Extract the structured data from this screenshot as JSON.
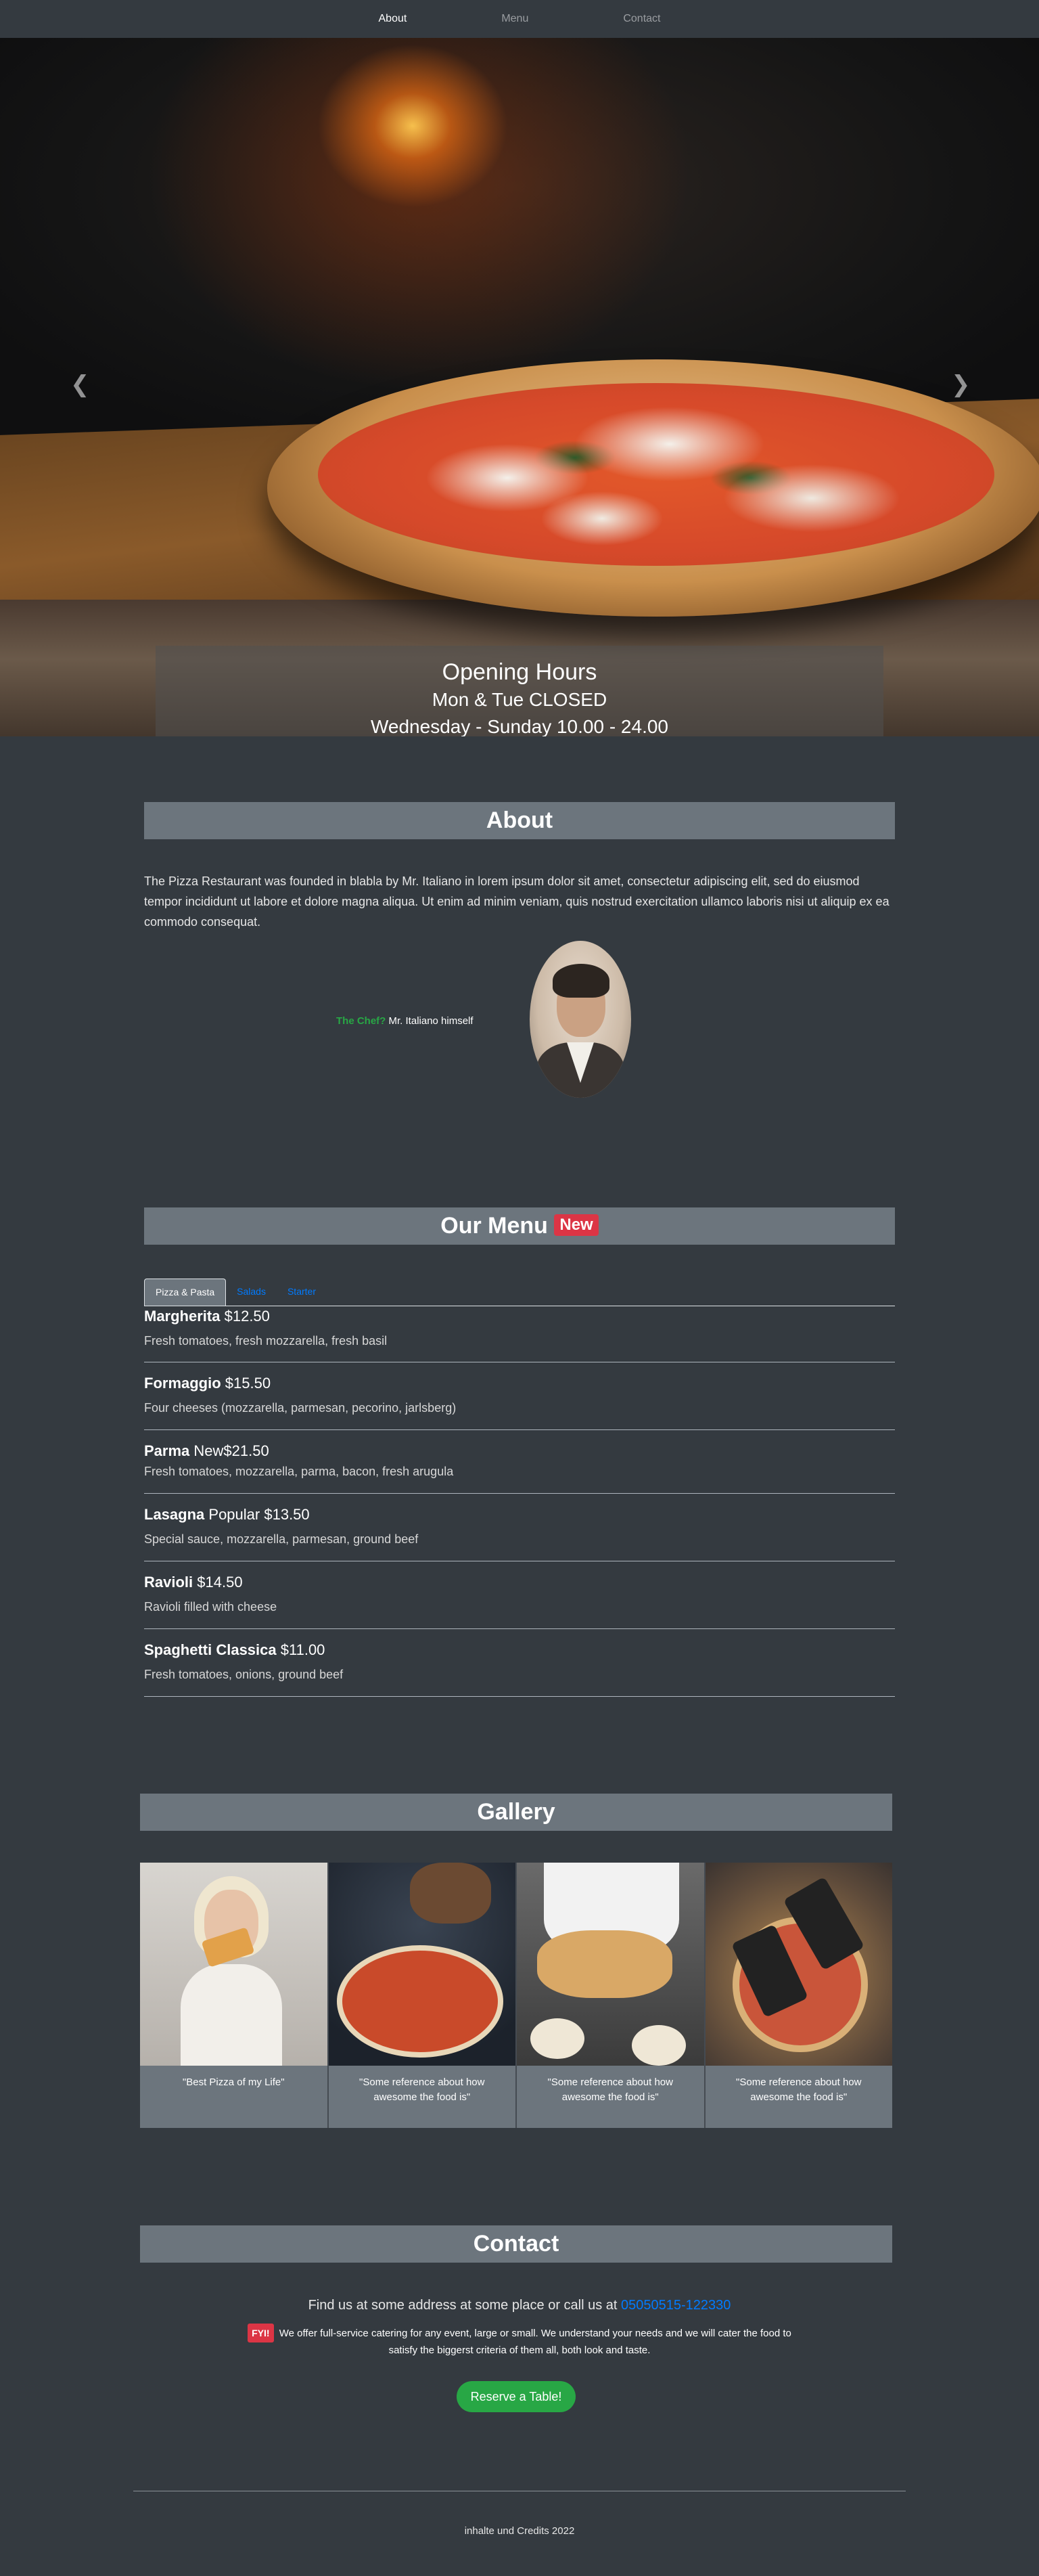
{
  "nav": {
    "items": [
      {
        "label": "About",
        "active": true
      },
      {
        "label": "Menu",
        "active": false
      },
      {
        "label": "Contact",
        "active": false
      }
    ]
  },
  "hero": {
    "caption_title": "Opening Hours",
    "caption_sub": "Mon & Tue CLOSED",
    "caption_hours": "Wednesday - Sunday 10.00 - 24.00",
    "prev_icon": "chevron-left-icon",
    "next_icon": "chevron-right-icon",
    "slide_count": 3,
    "active_slide": 2
  },
  "about": {
    "heading": "About",
    "text": "The Pizza Restaurant was founded in blabla by Mr. Italiano in lorem ipsum dolor sit amet, consectetur adipiscing elit, sed do eiusmod tempor incididunt ut labore et dolore magna aliqua. Ut enim ad minim veniam, quis nostrud exercitation ullamco laboris nisi ut aliquip ex ea commodo consequat.",
    "chef_label": "The Chef?",
    "chef_name": "Mr. Italiano himself"
  },
  "menu": {
    "heading": "Our Menu",
    "badge": "New",
    "tabs": [
      {
        "label": "Pizza & Pasta",
        "active": true
      },
      {
        "label": "Salads",
        "active": false
      },
      {
        "label": "Starter",
        "active": false
      }
    ],
    "items": [
      {
        "name": "Margherita",
        "tag": "",
        "price": "$12.50",
        "desc": "Fresh tomatoes, fresh mozzarella, fresh basil"
      },
      {
        "name": "Formaggio",
        "tag": "",
        "price": "$15.50",
        "desc": "Four cheeses (mozzarella, parmesan, pecorino, jarlsberg)"
      },
      {
        "name": "Parma",
        "tag": "New",
        "price": "$21.50",
        "desc": "Fresh tomatoes, mozzarella, parma, bacon, fresh arugula"
      },
      {
        "name": "Lasagna",
        "tag": "Popular",
        "price": "$13.50",
        "desc": "Special sauce, mozzarella, parmesan, ground beef"
      },
      {
        "name": "Ravioli",
        "tag": "",
        "price": "$14.50",
        "desc": "Ravioli filled with cheese"
      },
      {
        "name": "Spaghetti Classica",
        "tag": "",
        "price": "$11.00",
        "desc": "Fresh tomatoes, onions, ground beef"
      }
    ]
  },
  "gallery": {
    "heading": "Gallery",
    "cards": [
      {
        "caption": "\"Best Pizza of my Life\""
      },
      {
        "caption": "\"Some reference about how awesome the food is\""
      },
      {
        "caption": "\"Some reference about how awesome the food is\""
      },
      {
        "caption": "\"Some reference about how awesome the food is\""
      }
    ]
  },
  "contact": {
    "heading": "Contact",
    "line": "Find us at some address at some place or call us at",
    "phone": "05050515-122330",
    "fyi_badge": "FYI!",
    "fyi_text": "We offer full-service catering for any event, large or small. We understand your needs and we will cater the food to satisfy the biggerst criteria of them all, both look and taste.",
    "button": "Reserve a Table!"
  },
  "footer": {
    "text": "inhalte und Credits 2022"
  },
  "colors": {
    "background": "#343a40",
    "heading_bar": "#6c757d",
    "accent_green": "#28a745",
    "accent_red": "#dc3545",
    "link_blue": "#007bff"
  }
}
